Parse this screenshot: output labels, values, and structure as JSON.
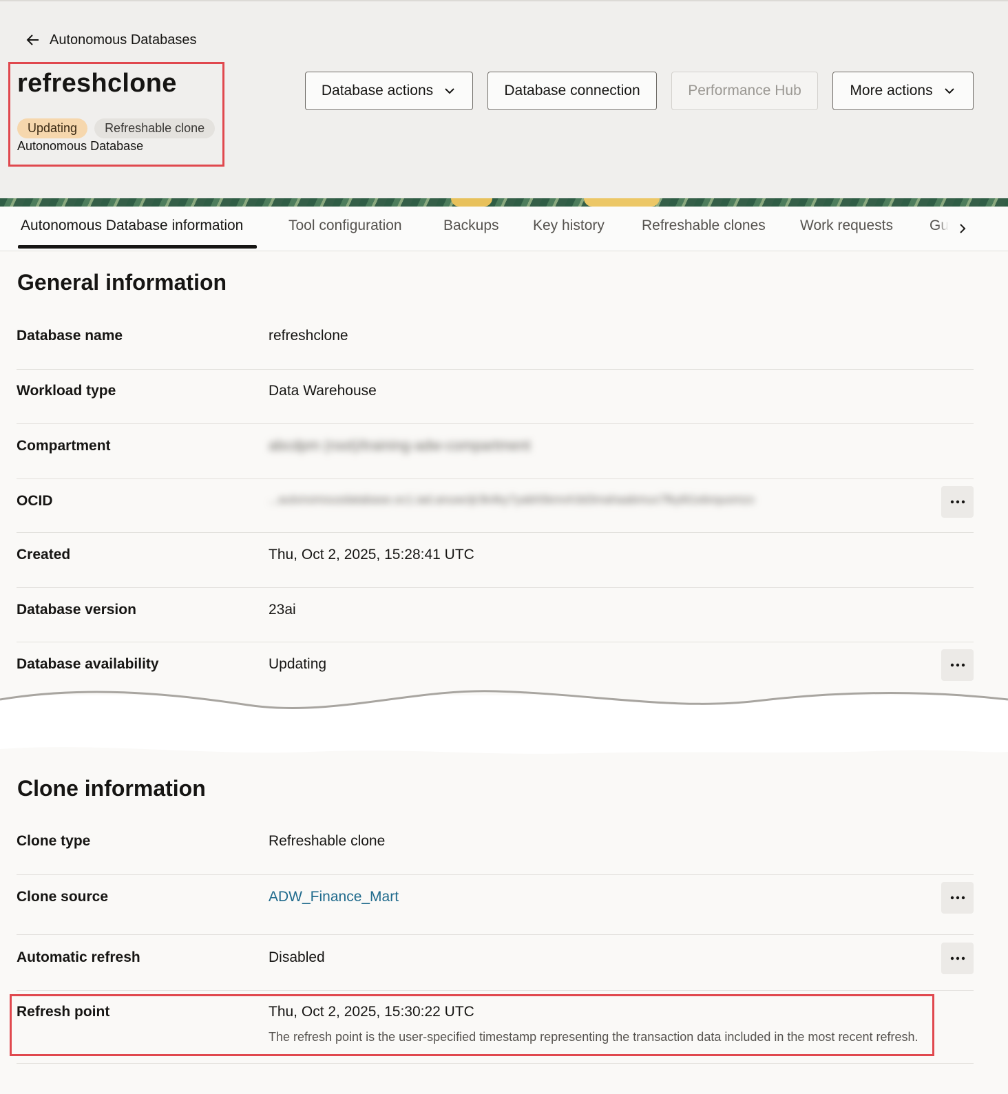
{
  "header": {
    "back_label": "Autonomous Databases",
    "title": "refreshclone",
    "badges": {
      "state": "Updating",
      "type": "Refreshable clone"
    },
    "subtitle": "Autonomous Database",
    "actions": {
      "database_actions": "Database actions",
      "database_connection": "Database connection",
      "performance_hub": "Performance Hub",
      "more_actions": "More actions"
    }
  },
  "tabs": {
    "items": [
      {
        "label": "Autonomous Database information",
        "active": true
      },
      {
        "label": "Tool configuration"
      },
      {
        "label": "Backups"
      },
      {
        "label": "Key history"
      },
      {
        "label": "Refreshable clones"
      },
      {
        "label": "Work requests"
      },
      {
        "label": "Gu"
      }
    ]
  },
  "general": {
    "heading": "General information",
    "rows": [
      {
        "label": "Database name",
        "value": "refreshclone"
      },
      {
        "label": "Workload type",
        "value": "Data Warehouse"
      },
      {
        "label": "Compartment",
        "value": "abcdpm (root)/training-adw-compartment"
      },
      {
        "label": "OCID",
        "value": "...autonomousdatabase.oc1.iad.anuwcljr3k4ky7yabh5kmvh3d3mahaabmux7fky6t1ebrquomzx"
      },
      {
        "label": "Created",
        "value": "Thu, Oct 2, 2025, 15:28:41 UTC"
      },
      {
        "label": "Database version",
        "value": "23ai"
      },
      {
        "label": "Database availability",
        "value": "Updating"
      }
    ]
  },
  "clone": {
    "heading": "Clone information",
    "rows": [
      {
        "label": "Clone type",
        "value": "Refreshable clone"
      },
      {
        "label": "Clone source",
        "value": "ADW_Finance_Mart"
      },
      {
        "label": "Automatic refresh",
        "value": "Disabled"
      },
      {
        "label": "Refresh point",
        "value": "Thu, Oct 2, 2025, 15:30:22 UTC",
        "hint": "The refresh point is the user-specified timestamp representing the transaction data included in the most recent refresh."
      }
    ]
  },
  "colors": {
    "accent_highlight": "#e0484e",
    "link": "#1f6a8c",
    "badge_updating": "#f6d7ad"
  },
  "icons": {
    "back": "arrow-left-icon",
    "dropdown": "chevron-down-icon",
    "overflow": "more-horizontal-icon",
    "tab_next": "chevron-right-icon"
  }
}
